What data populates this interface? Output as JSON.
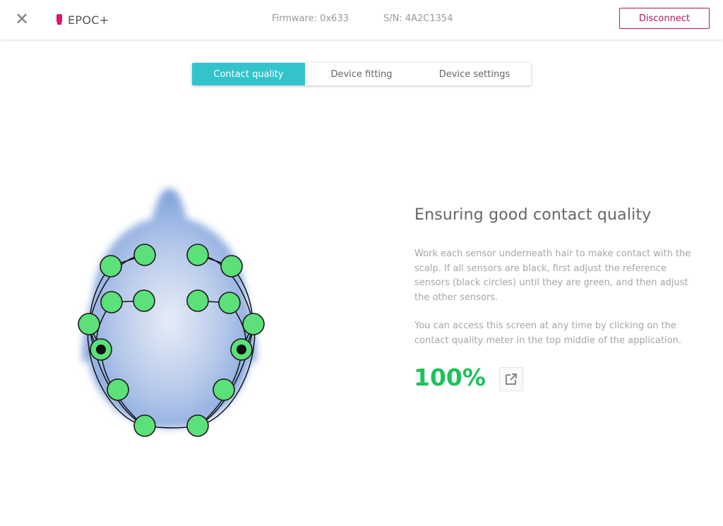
{
  "topbar": {
    "close_glyph": "✕",
    "app_name": "EPOC+",
    "firmware": "Firmware: 0x633",
    "serial": "S/N: 4A2C1354",
    "disconnect_label": "Disconnect"
  },
  "tabs": [
    {
      "label": "Contact quality",
      "active": true
    },
    {
      "label": "Device fitting",
      "active": false
    },
    {
      "label": "Device settings",
      "active": false
    }
  ],
  "info": {
    "title": "Ensuring good contact quality",
    "paragraph1": "Work each sensor underneath hair to make contact with the scalp. If all sensors are black, first adjust the reference sensors (black circles) until they are green, and then adjust the other sensors.",
    "paragraph2": "You can access this screen at any time by clicking on the contact quality meter in the top middle of the application.",
    "quality_value": "100%"
  },
  "sensors": {
    "total": 16,
    "good": 14,
    "reference": 2,
    "status_color_good": "#5be07a",
    "reference_color": "#000000"
  },
  "colors": {
    "accent_teal": "#33c4cb",
    "brand_magenta": "#b0175b",
    "quality_green": "#1cc35a",
    "head_blue": "#7fa3d8"
  },
  "icons": {
    "close": "close-icon",
    "device": "headset-device-icon",
    "popout": "external-link-icon"
  }
}
